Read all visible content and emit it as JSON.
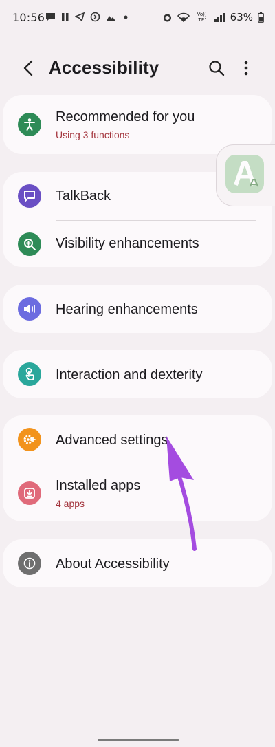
{
  "status_bar": {
    "time": "10:56",
    "battery": "63%",
    "network_label": "Vo)) LTE1"
  },
  "app_bar": {
    "title": "Accessibility",
    "back_icon": "arrow-back-icon",
    "search_icon": "search-icon",
    "more_icon": "more-vert-icon"
  },
  "cards": {
    "recommended": {
      "title": "Recommended for you",
      "subtitle": "Using 3 functions",
      "icon_color": "#2e8b57"
    },
    "talkback": {
      "title": "TalkBack",
      "icon_color": "#6a4fc4"
    },
    "visibility": {
      "title": "Visibility enhancements",
      "icon_color": "#2e8b57"
    },
    "hearing": {
      "title": "Hearing enhancements",
      "icon_color": "#6c6ce0"
    },
    "interaction": {
      "title": "Interaction and dexterity",
      "icon_color": "#2aa79b"
    },
    "advanced": {
      "title": "Advanced settings",
      "icon_color": "#f2931c"
    },
    "installed": {
      "title": "Installed apps",
      "subtitle": "4 apps",
      "icon_color": "#e06a7a"
    },
    "about": {
      "title": "About Accessibility",
      "icon_color": "#6f6f6f"
    }
  },
  "floating_bubble": {
    "icon": "accessibility-text-bubble-icon"
  },
  "annotation": {
    "color": "#a44ce0"
  }
}
